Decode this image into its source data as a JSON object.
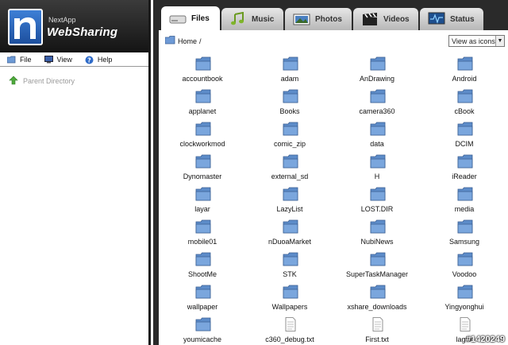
{
  "brand": {
    "small": "NextApp",
    "big": "WebSharing"
  },
  "menu": [
    {
      "label": "File",
      "icon": "folder-icon"
    },
    {
      "label": "View",
      "icon": "monitor-icon"
    },
    {
      "label": "Help",
      "icon": "help-icon"
    }
  ],
  "sidebar": {
    "parent_label": "Parent Directory"
  },
  "tabs": [
    {
      "label": "Files",
      "icon": "drive-icon",
      "active": true
    },
    {
      "label": "Music",
      "icon": "music-note-icon"
    },
    {
      "label": "Photos",
      "icon": "photo-icon"
    },
    {
      "label": "Videos",
      "icon": "clapperboard-icon"
    },
    {
      "label": "Status",
      "icon": "status-monitor-icon"
    }
  ],
  "breadcrumb": {
    "home": "Home",
    "separator": "/"
  },
  "view_select": {
    "value": "View as icons"
  },
  "files": [
    {
      "name": "accountbook",
      "type": "folder"
    },
    {
      "name": "adam",
      "type": "folder"
    },
    {
      "name": "AnDrawing",
      "type": "folder"
    },
    {
      "name": "Android",
      "type": "folder"
    },
    {
      "name": "applanet",
      "type": "folder"
    },
    {
      "name": "Books",
      "type": "folder"
    },
    {
      "name": "camera360",
      "type": "folder"
    },
    {
      "name": "cBook",
      "type": "folder"
    },
    {
      "name": "clockworkmod",
      "type": "folder"
    },
    {
      "name": "comic_zip",
      "type": "folder"
    },
    {
      "name": "data",
      "type": "folder"
    },
    {
      "name": "DCIM",
      "type": "folder"
    },
    {
      "name": "Dynomaster",
      "type": "folder"
    },
    {
      "name": "external_sd",
      "type": "folder"
    },
    {
      "name": "H",
      "type": "folder"
    },
    {
      "name": "iReader",
      "type": "folder"
    },
    {
      "name": "layar",
      "type": "folder"
    },
    {
      "name": "LazyList",
      "type": "folder"
    },
    {
      "name": "LOST.DIR",
      "type": "folder"
    },
    {
      "name": "media",
      "type": "folder"
    },
    {
      "name": "mobile01",
      "type": "folder"
    },
    {
      "name": "nDuoaMarket",
      "type": "folder"
    },
    {
      "name": "NubiNews",
      "type": "folder"
    },
    {
      "name": "Samsung",
      "type": "folder"
    },
    {
      "name": "ShootMe",
      "type": "folder"
    },
    {
      "name": "STK",
      "type": "folder"
    },
    {
      "name": "SuperTaskManager",
      "type": "folder"
    },
    {
      "name": "Voodoo",
      "type": "folder"
    },
    {
      "name": "wallpaper",
      "type": "folder"
    },
    {
      "name": "Wallpapers",
      "type": "folder"
    },
    {
      "name": "xshare_downloads",
      "type": "folder"
    },
    {
      "name": "Yingyonghui",
      "type": "folder"
    },
    {
      "name": "youmicache",
      "type": "folder"
    },
    {
      "name": "c360_debug.txt",
      "type": "file"
    },
    {
      "name": "First.txt",
      "type": "file"
    },
    {
      "name": "lagfix",
      "type": "file"
    }
  ],
  "watermark": "#1420249",
  "colors": {
    "folder": "#6d9ad6",
    "tab_bar": "#2a2a2a",
    "logo_blue": "#2b64bb"
  }
}
